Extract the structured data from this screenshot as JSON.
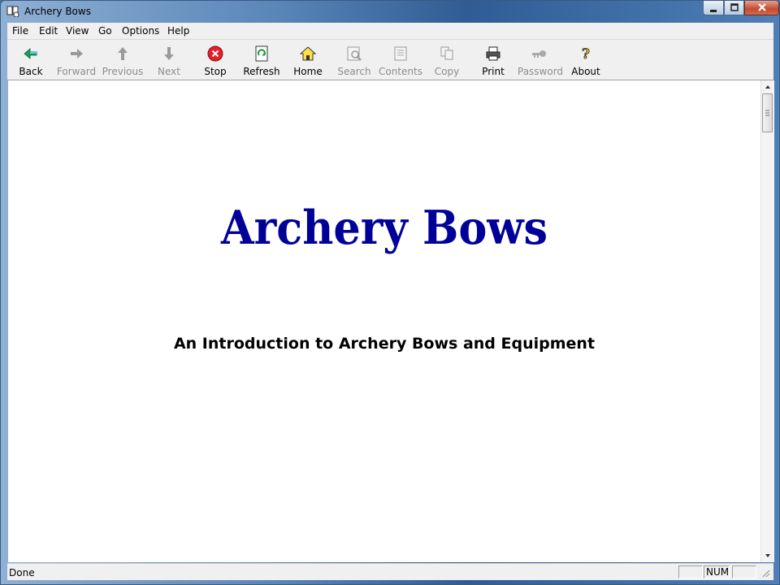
{
  "window": {
    "title": "Archery Bows"
  },
  "menu": [
    "File",
    "Edit",
    "View",
    "Go",
    "Options",
    "Help"
  ],
  "toolbar": {
    "back": "Back",
    "forward": "Forward",
    "previous": "Previous",
    "next": "Next",
    "stop": "Stop",
    "refresh": "Refresh",
    "home": "Home",
    "search": "Search",
    "contents": "Contents",
    "copy": "Copy",
    "print": "Print",
    "password": "Password",
    "about": "About"
  },
  "document": {
    "title": "Archery Bows",
    "subtitle": "An Introduction to Archery Bows and Equipment",
    "title_color": "#000099"
  },
  "status": {
    "text": "Done",
    "panel1": "",
    "panel2": "NUM",
    "panel3": ""
  },
  "colors": {
    "chrome": "#f0f0f0",
    "accent": "#2f5c94"
  }
}
